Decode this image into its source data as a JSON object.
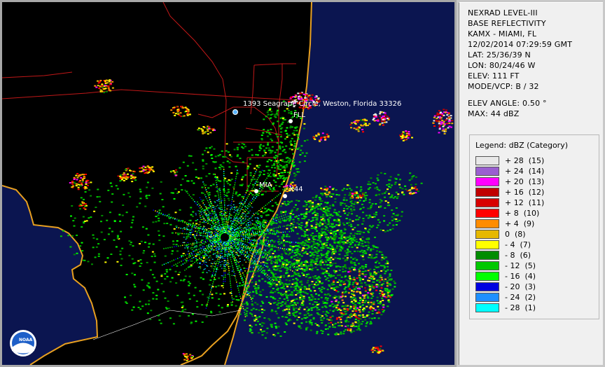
{
  "header": {
    "product": "NEXRAD LEVEL-III",
    "type": "BASE REFLECTIVITY",
    "station": "KAMX - MIAMI, FL",
    "datetime": "12/02/2014 07:29:59 GMT",
    "lat": "LAT: 25/36/39 N",
    "lon": "LON: 80/24/46 W",
    "elev": "ELEV: 111 FT",
    "mode": "MODE/VCP: B / 32",
    "elev_angle": "ELEV ANGLE: 0.50 °",
    "max": "MAX: 44 dBZ"
  },
  "legend": {
    "title": "Legend: dBZ (Category)",
    "items": [
      {
        "label": "+ 28  (15)",
        "color": "#e8e8e8"
      },
      {
        "label": "+ 24  (14)",
        "color": "#9a5fd0"
      },
      {
        "label": "+ 20  (13)",
        "color": "#ff00ff"
      },
      {
        "label": "+ 16  (12)",
        "color": "#c00000"
      },
      {
        "label": "+ 12  (11)",
        "color": "#d80000"
      },
      {
        "label": "+ 8  (10)",
        "color": "#ff0000"
      },
      {
        "label": "+ 4  (9)",
        "color": "#ff8c00"
      },
      {
        "label": "0  (8)",
        "color": "#e6b800"
      },
      {
        "label": "- 4  (7)",
        "color": "#ffff00"
      },
      {
        "label": "- 8  (6)",
        "color": "#008c00"
      },
      {
        "label": "- 12  (5)",
        "color": "#00c800"
      },
      {
        "label": "- 16  (4)",
        "color": "#00ff00"
      },
      {
        "label": "- 20  (3)",
        "color": "#0000e0"
      },
      {
        "label": "- 24  (2)",
        "color": "#1e90ff"
      },
      {
        "label": "- 28  (1)",
        "color": "#00ffff"
      }
    ]
  },
  "map": {
    "address_label": "1393 Seagrape Circle, Weston, Florida 33326",
    "fll_label": "FLL",
    "mia_label": "MIA",
    "x44_label": "X44",
    "logo_text": "NOAA",
    "ocean_color": "#0b1550",
    "land_color": "#000000",
    "coast_color": "#e8a020",
    "road_color": "#c01818"
  }
}
